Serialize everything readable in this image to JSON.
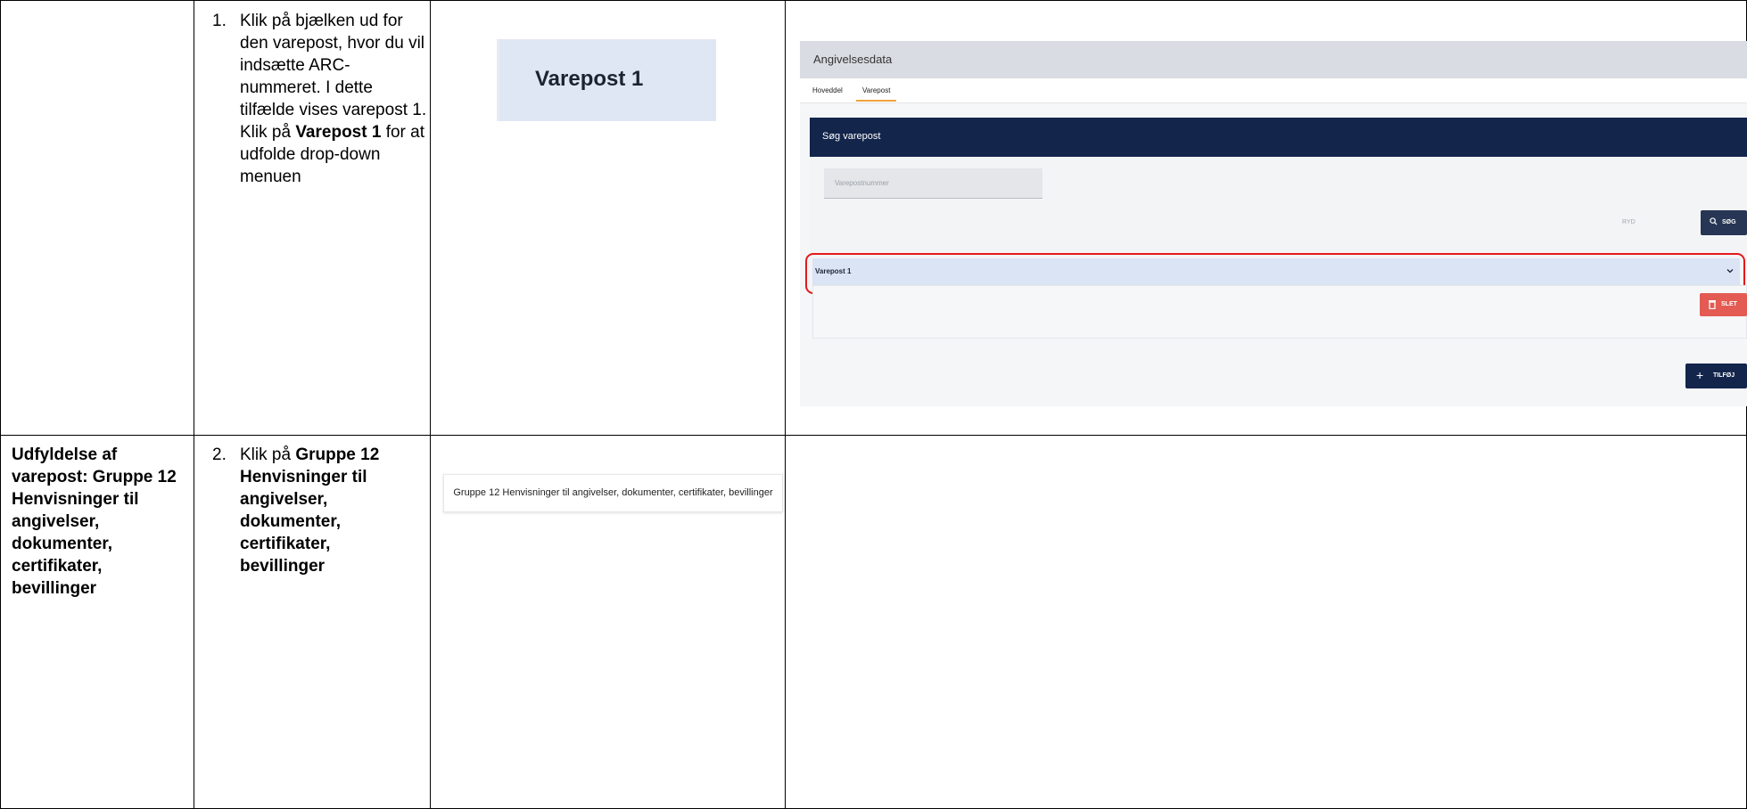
{
  "row1": {
    "step": {
      "number": "1.",
      "text_before": "Klik på bjælken ud for den varepost, hvor du vil indsætte ARC-nummeret. I dette tilfælde vises varepost 1. Klik på",
      "bold": "Varepost 1",
      "text_after": "for at udfolde drop-down menuen"
    },
    "snippet_label": "Varepost 1",
    "app": {
      "header_title": "Angivelsesdata",
      "tabs": [
        "Hoveddel",
        "Varepost"
      ],
      "active_tab": "Varepost",
      "search_panel_title": "Søg varepost",
      "search_input_placeholder": "Varepostnummer",
      "clear_label": "RYD",
      "search_button_label": "SØG",
      "varepost_row_label": "Varepost 1",
      "delete_button_label": "SLET",
      "add_button_label": "TILFØJ"
    }
  },
  "row2": {
    "section_title": "Udfyldelse af varepost: Gruppe 12 Henvisninger til angivelser, dokumenter, certifikater, bevillinger",
    "step": {
      "number": "2.",
      "text_before": "Klik på",
      "bold": "Gruppe 12 Henvisninger til angivelser, dokumenter, certifikater, bevillinger"
    },
    "snippet_label": "Gruppe 12 Henvisninger til angivelser, dokumenter, certifikater, bevillinger"
  },
  "colors": {
    "navy": "#13254b",
    "highlight_red": "#e4191b",
    "delete_red": "#e35b52",
    "row_blue": "#dbe4f4",
    "tab_accent": "#f0a23a"
  }
}
